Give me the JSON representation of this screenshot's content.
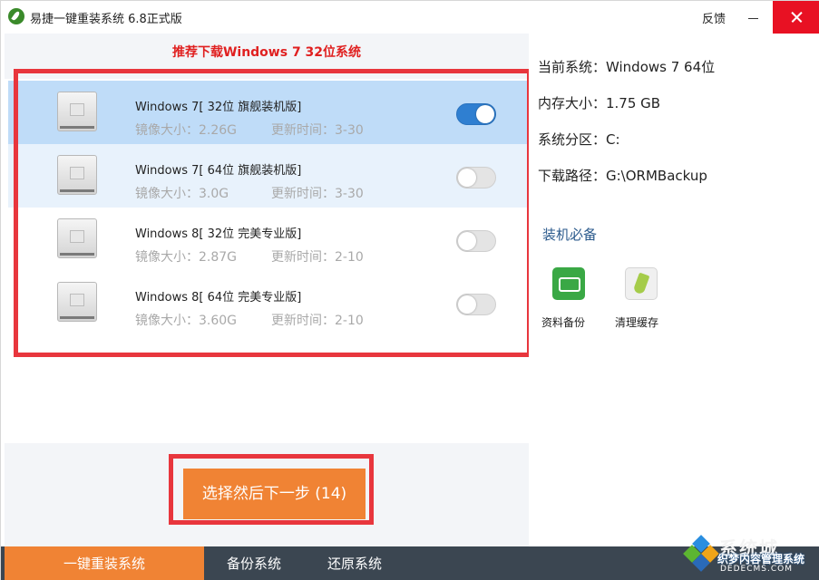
{
  "window": {
    "title": "易捷一键重装系统 6.8正式版",
    "feedback_label": "反馈"
  },
  "recommend_text": "推荐下载Windows 7 32位系统",
  "systems": [
    {
      "name": "Windows 7[ 32位 旗舰装机版]",
      "size": "镜像大小：2.26G",
      "updated": "更新时间：3-30",
      "enabled": true
    },
    {
      "name": "Windows 7[ 64位 旗舰装机版]",
      "size": "镜像大小：3.0G",
      "updated": "更新时间：3-30",
      "enabled": false
    },
    {
      "name": "Windows 8[ 32位 完美专业版]",
      "size": "镜像大小：2.87G",
      "updated": "更新时间：2-10",
      "enabled": false
    },
    {
      "name": "Windows 8[ 64位 完美专业版]",
      "size": "镜像大小：3.60G",
      "updated": "更新时间：2-10",
      "enabled": false
    }
  ],
  "next_button_label": "选择然后下一步 (14)",
  "info": {
    "current_system": "当前系统：Windows 7 64位",
    "memory": "内存大小：1.75 GB",
    "partition": "系统分区：C:",
    "download_path": "下载路径：G:\\ORMBackup"
  },
  "tools": {
    "title": "装机必备",
    "backup_label": "资料备份",
    "clean_label": "清理缓存"
  },
  "nav": {
    "reinstall": "一键重装系统",
    "backup": "备份系统",
    "restore": "还原系统"
  },
  "watermark": {
    "line1": "系统城",
    "line2": "织梦内容管理系统",
    "line3": "DEDECMS.COM"
  },
  "colors": {
    "accent_orange": "#f08334",
    "highlight_red": "#e8363d",
    "toggle_on": "#2f7fd1",
    "selected_row": "#bfdcf8",
    "bottom_bar": "#3b4651"
  }
}
